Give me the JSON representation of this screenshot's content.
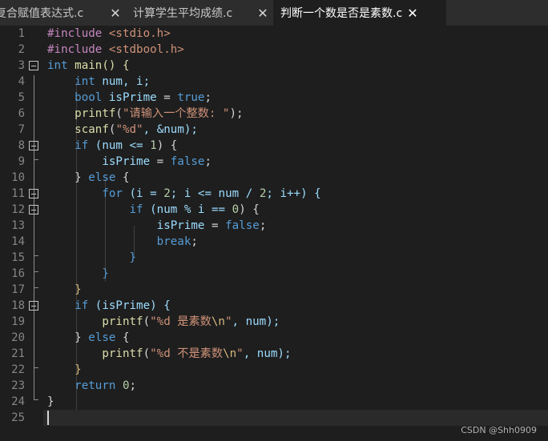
{
  "tabs": [
    {
      "label": "复合赋值表达式.c",
      "close": "✕",
      "active": false
    },
    {
      "label": "计算学生平均成绩.c",
      "close": "✕",
      "active": false
    },
    {
      "label": "判断一个数是否是素数.c",
      "close": "✕",
      "active": true
    }
  ],
  "line_numbers": [
    "1",
    "2",
    "3",
    "4",
    "5",
    "6",
    "7",
    "8",
    "9",
    "10",
    "11",
    "12",
    "13",
    "14",
    "15",
    "16",
    "17",
    "18",
    "19",
    "20",
    "21",
    "22",
    "23",
    "24",
    "25"
  ],
  "code": {
    "l1": {
      "a": "#include ",
      "b": "<stdio.h>"
    },
    "l2": {
      "a": "#include ",
      "b": "<stdbool.h>"
    },
    "l3": {
      "a": "int",
      "b": " main() {"
    },
    "l4": {
      "a": "    ",
      "b": "int",
      "c": " num, i;"
    },
    "l5": {
      "a": "    ",
      "b": "bool",
      "c": " ",
      "d": "isPrime",
      "e": " = ",
      "f": "true",
      "g": ";"
    },
    "l6": {
      "a": "    ",
      "b": "printf",
      "c": "(",
      "d": "\"请输入一个整数: \"",
      "e": ");"
    },
    "l7": {
      "a": "    ",
      "b": "scanf",
      "c": "(",
      "d": "\"%d\"",
      "e": ", &num);"
    },
    "l8": {
      "a": "    ",
      "b": "if",
      "c": " (num <= ",
      "d": "1",
      "e": ") {"
    },
    "l9": {
      "a": "        ",
      "b": "isPrime",
      "c": " = ",
      "d": "false",
      "e": ";"
    },
    "l10": {
      "a": "    } ",
      "b": "else",
      "c": " {"
    },
    "l11": {
      "a": "        ",
      "b": "for",
      "c": " (i = ",
      "d": "2",
      "e": "; i <= num / ",
      "f": "2",
      "g": "; i++) {"
    },
    "l12": {
      "a": "            ",
      "b": "if",
      "c": " (num % i == ",
      "d": "0",
      "e": ") {"
    },
    "l13": {
      "a": "                ",
      "b": "isPrime",
      "c": " = ",
      "d": "false",
      "e": ";"
    },
    "l14": {
      "a": "                ",
      "b": "break",
      "c": ";"
    },
    "l15": {
      "a": "            }"
    },
    "l16": {
      "a": "        }"
    },
    "l17": {
      "a": "    }"
    },
    "l18": {
      "a": "    ",
      "b": "if",
      "c": " (isPrime) {"
    },
    "l19": {
      "a": "        ",
      "b": "printf",
      "c": "(",
      "d": "\"%d 是素数",
      "e": "\\n",
      "f": "\"",
      "g": ", num);"
    },
    "l20": {
      "a": "    } ",
      "b": "else",
      "c": " {"
    },
    "l21": {
      "a": "        ",
      "b": "printf",
      "c": "(",
      "d": "\"%d 不是素数",
      "e": "\\n",
      "f": "\"",
      "g": ", num);"
    },
    "l22": {
      "a": "    }"
    },
    "l23": {
      "a": "    ",
      "b": "return",
      "c": " ",
      "d": "0",
      "e": ";"
    },
    "l24": {
      "a": "}"
    }
  },
  "watermark": "CSDN @Shh0909",
  "colors": {
    "keyword": "#569cd6",
    "preprocessor": "#c586c0",
    "string": "#ce9178",
    "number": "#b5cea8",
    "function": "#dcdcaa",
    "variable": "#9cdcfe",
    "background": "#1e1e1e"
  }
}
